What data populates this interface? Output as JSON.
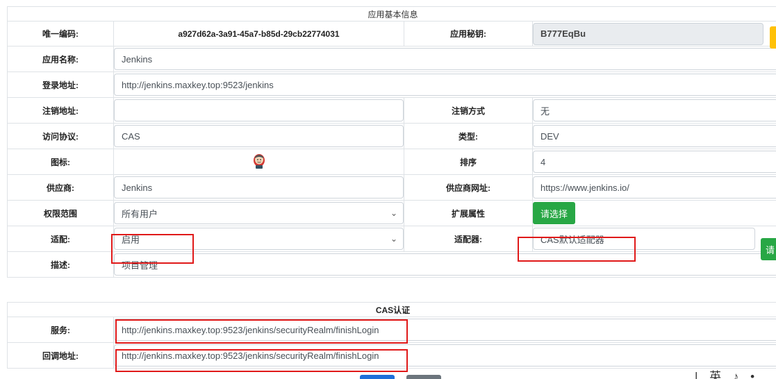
{
  "section_basic": {
    "title": "应用基本信息"
  },
  "fields": {
    "id_label": "唯一编码:",
    "id_value": "a927d62a-3a91-45a7-b85d-29cb22774031",
    "secret_label": "应用秘钥:",
    "secret_value": "B777EqBu",
    "name_label": "应用名称:",
    "name_value": "Jenkins",
    "login_label": "登录地址:",
    "login_value": "http://jenkins.maxkey.top:9523/jenkins",
    "logout_label": "注销地址:",
    "logout_value": "",
    "logout_type_label": "注销方式",
    "logout_type_value": "无",
    "protocol_label": "访问协议:",
    "protocol_value": "CAS",
    "category_label": "类型:",
    "category_value": "DEV",
    "icon_label": "图标:",
    "sort_label": "排序",
    "sort_value": "4",
    "vendor_label": "供应商:",
    "vendor_value": "Jenkins",
    "vendor_url_label": "供应商网址:",
    "vendor_url_value": "https://www.jenkins.io/",
    "scope_label": "权限范围",
    "scope_value": "所有用户",
    "ext_label": "扩展属性",
    "ext_button": "请选择",
    "adapter_enable_label": "适配:",
    "adapter_enable_value": "启用",
    "adapter_label": "适配器:",
    "adapter_value": "CAS默认适配器",
    "adapter_button": "请",
    "desc_label": "描述:",
    "desc_value": "项目管理"
  },
  "section_cas": {
    "title": "CAS认证"
  },
  "cas": {
    "service_label": "服务:",
    "service_value": "http://jenkins.maxkey.top:9523/jenkins/securityRealm/finishLogin",
    "callback_label": "回调地址:",
    "callback_value": "http://jenkins.maxkey.top:9523/jenkins/securityRealm/finishLogin"
  },
  "ime": {
    "text": "| 英 ♪ •,"
  },
  "colors": {
    "accent_green": "#28a745",
    "highlight_red": "#e01919",
    "yellow_button": "#ffc107",
    "blue_button": "#1e6fd9",
    "gray_button": "#6c757d"
  }
}
